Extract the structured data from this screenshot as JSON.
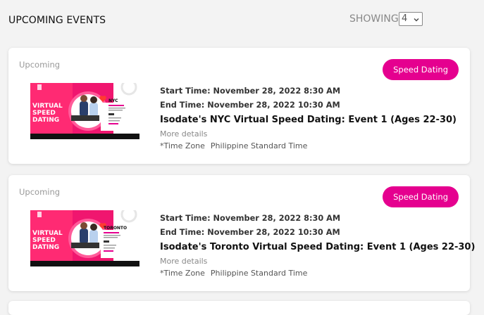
{
  "header": {
    "title": "UPCOMING EVENTS",
    "showing_label": "SHOWING",
    "showing_value": "4"
  },
  "events": [
    {
      "status": "Upcoming",
      "category": "Speed Dating",
      "start_time": "Start Time: November 28, 2022 8:30 AM",
      "end_time": "End Time: November 28, 2022 10:30 AM",
      "title": "Isodate's NYC Virtual Speed Dating: Event 1 (Ages 22-30)",
      "more_details": "More details",
      "timezone_label": "*Time Zone",
      "timezone_value": "Philippine Standard Time",
      "thumbnail": {
        "line1": "VIRTUAL",
        "line2": "SPEED",
        "line3": "DATING",
        "city": "NYC"
      }
    },
    {
      "status": "Upcoming",
      "category": "Speed Dating",
      "start_time": "Start Time: November 28, 2022 8:30 AM",
      "end_time": "End Time: November 28, 2022 10:30 AM",
      "title": "Isodate's Toronto Virtual Speed Dating: Event 1 (Ages 22-30)",
      "more_details": "More details",
      "timezone_label": "*Time Zone",
      "timezone_value": "Philippine Standard Time",
      "thumbnail": {
        "line1": "VIRTUAL",
        "line2": "SPEED",
        "line3": "DATING",
        "city": "TORONTO"
      }
    }
  ],
  "colors": {
    "accent": "#e5008f",
    "background": "#f3f3f3",
    "card": "#ffffff"
  },
  "icons": {
    "select_arrow": "chevron-down-icon"
  }
}
